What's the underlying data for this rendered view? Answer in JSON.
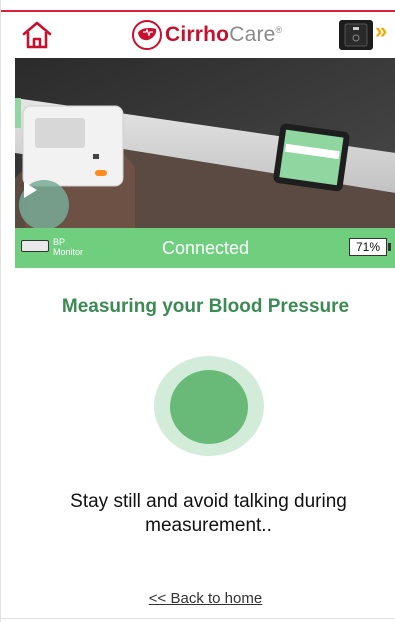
{
  "header": {
    "logo_bold": "Cirrho",
    "logo_light": "Care",
    "logo_reg": "®",
    "next_arrows": "»"
  },
  "colors": {
    "brand_red": "#c8102e",
    "brand_green": "#6fcf7f",
    "title_green": "#3c8a54",
    "pulse_inner": "#69b979",
    "pulse_outer": "#d3ecd9",
    "arrow_yellow": "#f2a900"
  },
  "icons": {
    "home": "home-icon",
    "play": "play-icon",
    "logo": "cirrhocare-logo-icon",
    "device": "bp-monitor-icon",
    "battery": "battery-icon"
  },
  "status_bar": {
    "device_label": "BP Monitor",
    "connection": "Connected",
    "battery": "71%",
    "battery_level": 0.71
  },
  "main": {
    "title": "Measuring your Blood Pressure",
    "instruction": "Stay still and avoid talking during measurement..",
    "back_link": "<< Back to home"
  }
}
